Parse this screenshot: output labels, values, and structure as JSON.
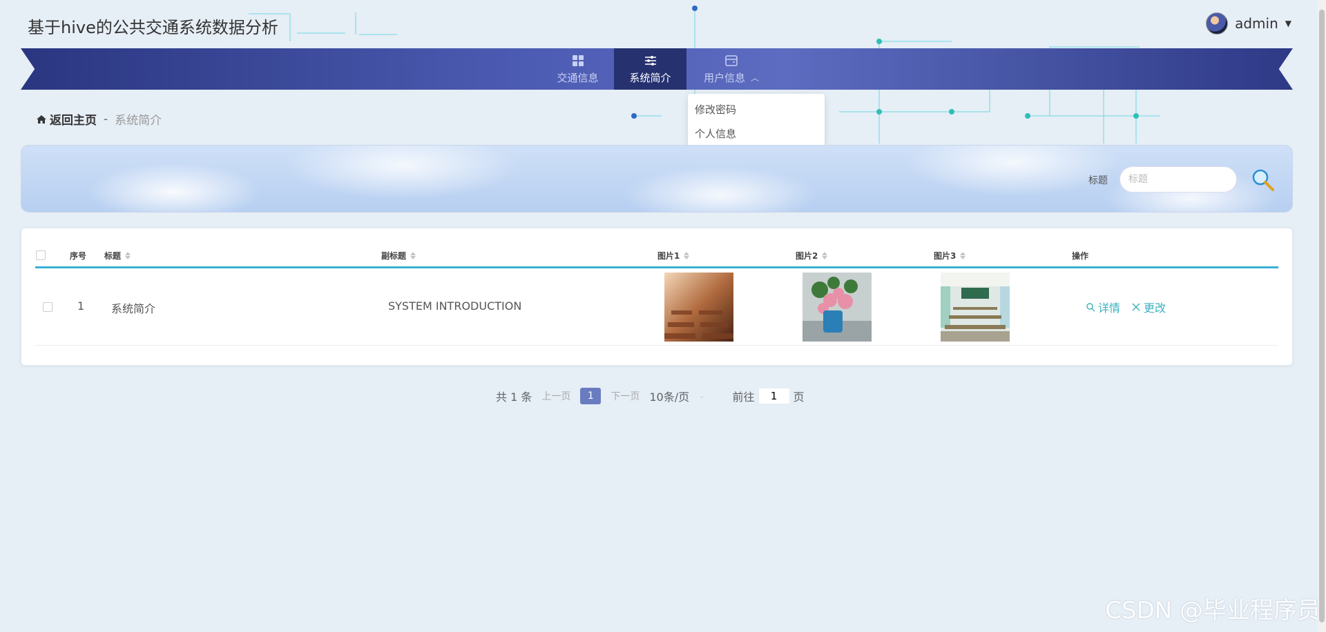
{
  "app": {
    "title": "基于hive的公共交通系统数据分析"
  },
  "user": {
    "name": "admin"
  },
  "nav": {
    "items": [
      {
        "label": "交通信息",
        "icon": "grid-icon"
      },
      {
        "label": "系统简介",
        "icon": "sliders-icon"
      },
      {
        "label": "用户信息",
        "icon": "wallet-icon"
      }
    ],
    "active_index": 1,
    "dropdown": [
      "修改密码",
      "个人信息"
    ]
  },
  "breadcrumb": {
    "home": "返回主页",
    "sep": "-",
    "current": "系统简介"
  },
  "search": {
    "label": "标题",
    "placeholder": "标题"
  },
  "table": {
    "headers": [
      "序号",
      "标题",
      "副标题",
      "图片1",
      "图片2",
      "图片3",
      "操作"
    ],
    "rows": [
      {
        "index": "1",
        "title": "系统简介",
        "subtitle": "SYSTEM INTRODUCTION",
        "actions": [
          "详情",
          "更改"
        ]
      }
    ]
  },
  "pagination": {
    "total": "共 1 条",
    "prev": "上一页",
    "page": "1",
    "next": "下一页",
    "size": "10条/页",
    "goto": "前往",
    "goto_value": "1",
    "page_unit": "页"
  },
  "watermark": "CSDN @毕业程序员",
  "colors": {
    "nav": "#4d5cb3",
    "accent": "#3bb0d6",
    "action": "#3bb0c0"
  }
}
